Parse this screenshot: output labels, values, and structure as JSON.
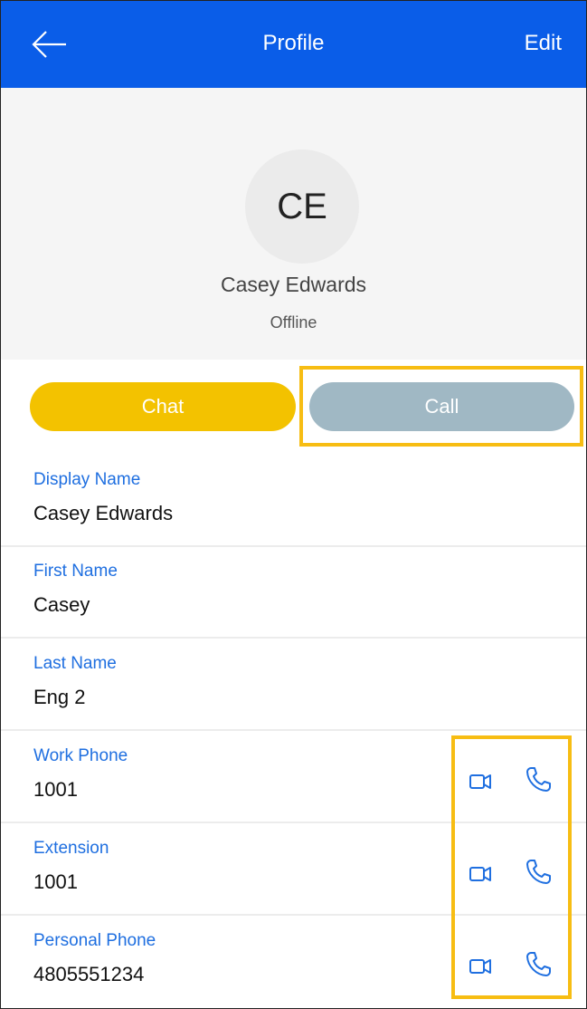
{
  "header": {
    "back_icon": "arrow-left-icon",
    "title": "Profile",
    "edit_label": "Edit"
  },
  "profile": {
    "initials": "CE",
    "name": "Casey Edwards",
    "status": "Offline"
  },
  "actions": {
    "chat_label": "Chat",
    "call_label": "Call"
  },
  "fields": [
    {
      "label": "Display Name",
      "value": "Casey Edwards"
    },
    {
      "label": "First Name",
      "value": "Casey"
    },
    {
      "label": "Last Name",
      "value": "Eng 2"
    },
    {
      "label": "Work Phone",
      "value": "1001",
      "icons": [
        "video-call-icon",
        "phone-icon"
      ]
    },
    {
      "label": "Extension",
      "value": "1001",
      "icons": [
        "video-call-icon",
        "phone-icon"
      ]
    },
    {
      "label": "Personal Phone",
      "value": "4805551234",
      "icons": [
        "video-call-icon",
        "phone-icon"
      ]
    }
  ],
  "colors": {
    "header": "#0a5de8",
    "chat_button": "#f3c200",
    "call_button": "#a0b8c4",
    "label": "#1f6fe0",
    "highlight": "#f7bd13"
  }
}
